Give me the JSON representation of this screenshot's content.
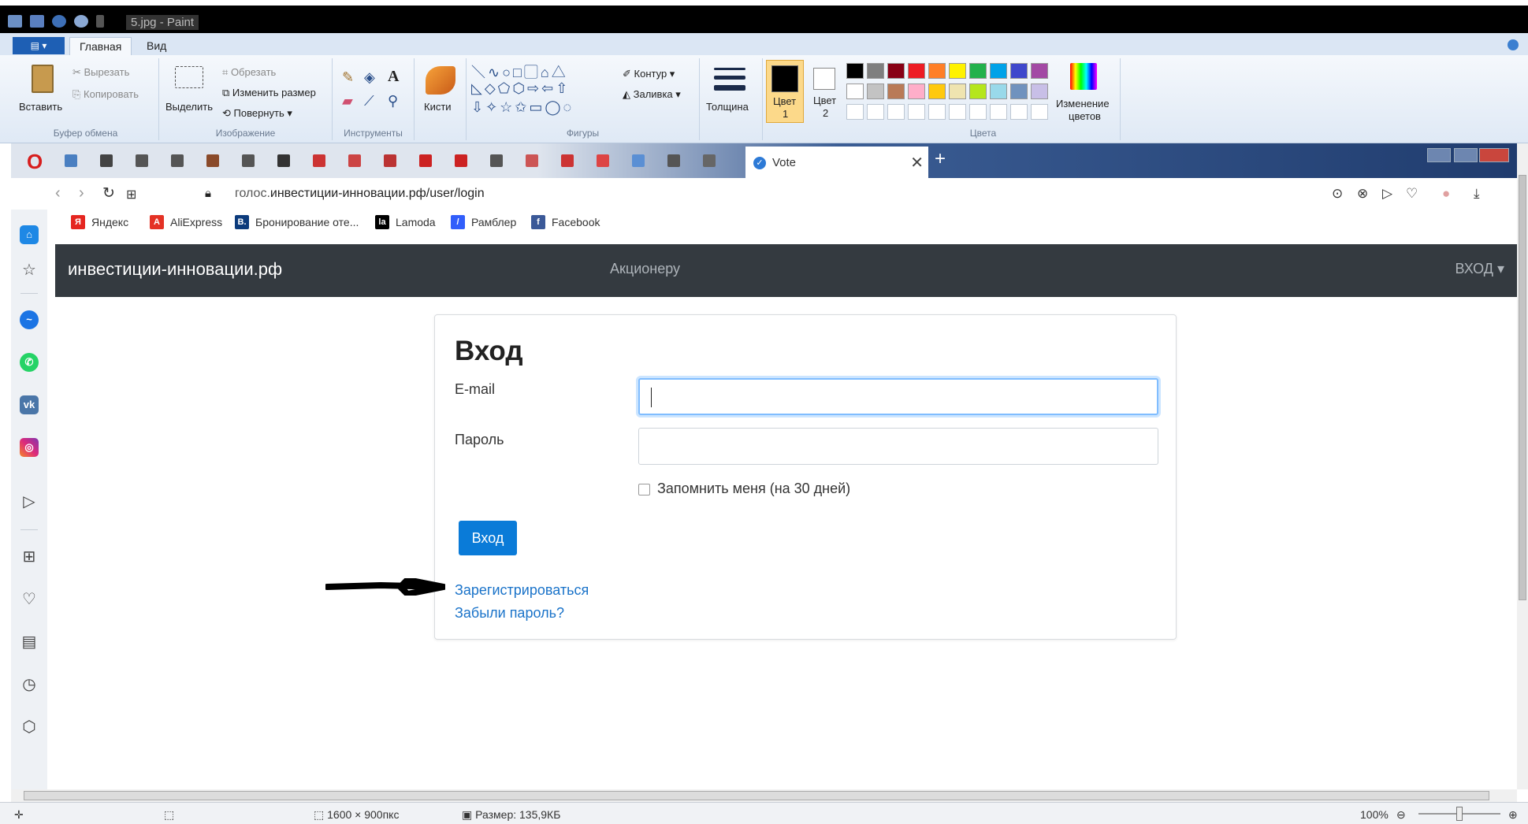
{
  "paint": {
    "title": "5.jpg - Paint",
    "tabs": [
      "Главная",
      "Вид"
    ],
    "groups": {
      "clipboard": {
        "label": "Буфер обмена",
        "paste": "Вставить",
        "cut": "Вырезать",
        "copy": "Копировать"
      },
      "image": {
        "label": "Изображение",
        "select": "Выделить",
        "crop": "Обрезать",
        "resize": "Изменить размер",
        "rotate": "Повернуть"
      },
      "tools": {
        "label": "Инструменты"
      },
      "brushes": {
        "label": "Кисти"
      },
      "shapes": {
        "label": "Фигуры",
        "outline": "Контур",
        "fill": "Заливка"
      },
      "thickness": {
        "label": "Толщина"
      },
      "color1": {
        "label": "Цвет",
        "num": "1"
      },
      "color2": {
        "label": "Цвет",
        "num": "2"
      },
      "colors": {
        "label": "Цвета",
        "edit_line1": "Изменение",
        "edit_line2": "цветов"
      }
    },
    "palette_row1": [
      "#000000",
      "#7f7f7f",
      "#880015",
      "#ed1c24",
      "#ff7f27",
      "#fff200",
      "#22b14c",
      "#00a2e8",
      "#3f48cc",
      "#a349a4"
    ],
    "palette_row2": [
      "#ffffff",
      "#c3c3c3",
      "#b97a57",
      "#ffaec9",
      "#ffc90e",
      "#efe4b0",
      "#b5e61d",
      "#99d9ea",
      "#7092be",
      "#c8bfe7"
    ],
    "status": {
      "dimensions": "1600 × 900пкс",
      "size": "Размер: 135,9КБ",
      "zoom": "100%"
    }
  },
  "browser": {
    "tab_title": "Vote",
    "url_host_prefix": "голос.",
    "url_rest": "инвестиции-инновации.рф/user/login",
    "bookmarks": [
      {
        "label": "Яндекс",
        "icon": "Я",
        "color": "#e52620"
      },
      {
        "label": "AliExpress",
        "icon": "A",
        "color": "#e43225"
      },
      {
        "label": "Бронирование оте...",
        "icon": "B.",
        "color": "#0c3b7c"
      },
      {
        "label": "Lamoda",
        "icon": "la",
        "color": "#000000"
      },
      {
        "label": "Рамблер",
        "icon": "/",
        "color": "#315efb"
      },
      {
        "label": "Facebook",
        "icon": "f",
        "color": "#3b5998"
      }
    ]
  },
  "site": {
    "brand": "инвестиции-инновации.рф",
    "nav_middle": "Акционеру",
    "nav_login": "ВХОД",
    "heading": "Вход",
    "email_label": "E-mail",
    "password_label": "Пароль",
    "remember_label": "Запомнить меня (на 30 дней)",
    "submit_label": "Вход",
    "register_link": "Зарегистрироваться",
    "forgot_link": "Забыли пароль?"
  }
}
